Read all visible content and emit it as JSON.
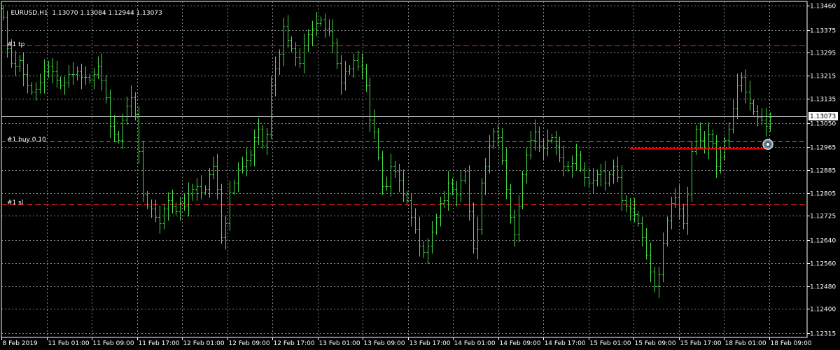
{
  "chart_info": {
    "symbol_tf": "EURUSD,H1",
    "ohlc": "1.13070 1.13084 1.12944 1.13073"
  },
  "levels": {
    "tp": {
      "label": "#1 tp",
      "price": 1.1332,
      "color": "#ff2020"
    },
    "buy": {
      "label": "#1 buy 0.10",
      "price": 1.12985,
      "color": "#20c020"
    },
    "sl": {
      "label": "#1 sl",
      "price": 1.12765,
      "color": "#ff2020"
    },
    "bid": {
      "label": "1.13073",
      "price": 1.13073
    }
  },
  "colors": {
    "background": "#000000",
    "bars": "#44dd44",
    "grid": "#8a8a8a",
    "axis_text": "#ffffff",
    "entry_line": "#ff0000"
  },
  "price_axis": {
    "ticks": [
      "1.13460",
      "1.13375",
      "1.13295",
      "1.13215",
      "1.13135",
      "1.13050",
      "1.12965",
      "1.12885",
      "1.12805",
      "1.12725",
      "1.12640",
      "1.12560",
      "1.12480",
      "1.12400",
      "1.12315"
    ]
  },
  "time_axis": {
    "labels": [
      "8 Feb 2019",
      "11 Feb 01:00",
      "11 Feb 09:00",
      "11 Feb 17:00",
      "12 Feb 01:00",
      "12 Feb 09:00",
      "12 Feb 17:00",
      "13 Feb 01:00",
      "13 Feb 09:00",
      "13 Feb 17:00",
      "14 Feb 01:00",
      "14 Feb 09:00",
      "14 Feb 17:00",
      "15 Feb 01:00",
      "15 Feb 09:00",
      "15 Feb 17:00",
      "18 Feb 01:00",
      "18 Feb 09:00"
    ]
  },
  "chart_data": {
    "type": "ohlc",
    "series": [
      {
        "name": "EURUSD,H1",
        "closes": [
          1.1342,
          1.1331,
          1.1326,
          1.1325,
          1.1327,
          1.1322,
          1.1318,
          1.1316,
          1.1317,
          1.1319,
          1.1323,
          1.1325,
          1.1323,
          1.132,
          1.1318,
          1.1319,
          1.1322,
          1.1322,
          1.1323,
          1.1321,
          1.1321,
          1.132,
          1.1322,
          1.1325,
          1.132,
          1.1314,
          1.1304,
          1.1301,
          1.1299,
          1.1306,
          1.1311,
          1.1314,
          1.1308,
          1.1295,
          1.128,
          1.1276,
          1.1275,
          1.1272,
          1.127,
          1.1275,
          1.1278,
          1.1276,
          1.1274,
          1.1277,
          1.1276,
          1.128,
          1.1282,
          1.1283,
          1.1281,
          1.1282,
          1.1287,
          1.129,
          1.1282,
          1.1265,
          1.127,
          1.1281,
          1.1284,
          1.1289,
          1.129,
          1.1292,
          1.1294,
          1.13,
          1.1303,
          1.1297,
          1.1301,
          1.1318,
          1.1324,
          1.1329,
          1.1339,
          1.1334,
          1.1331,
          1.1328,
          1.1326,
          1.1332,
          1.1336,
          1.1338,
          1.134,
          1.1341,
          1.1338,
          1.1337,
          1.1333,
          1.1326,
          1.1319,
          1.1323,
          1.1324,
          1.1327,
          1.1325,
          1.1324,
          1.1318,
          1.1306,
          1.1302,
          1.1293,
          1.1283,
          1.1283,
          1.129,
          1.1288,
          1.1285,
          1.128,
          1.1278,
          1.1272,
          1.1268,
          1.1262,
          1.126,
          1.1262,
          1.1267,
          1.1272,
          1.1277,
          1.1278,
          1.1284,
          1.1282,
          1.128,
          1.1285,
          1.1288,
          1.1274,
          1.1261,
          1.1268,
          1.1284,
          1.129,
          1.1297,
          1.1302,
          1.13,
          1.1292,
          1.1282,
          1.1272,
          1.1266,
          1.1276,
          1.1287,
          1.1294,
          1.1299,
          1.1302,
          1.1297,
          1.1296,
          1.1299,
          1.13,
          1.1297,
          1.1293,
          1.129,
          1.129,
          1.1291,
          1.1294,
          1.1289,
          1.1286,
          1.1284,
          1.1285,
          1.1287,
          1.1288,
          1.1284,
          1.1287,
          1.129,
          1.1286,
          1.1278,
          1.1276,
          1.1275,
          1.1273,
          1.127,
          1.1265,
          1.1259,
          1.1253,
          1.1248,
          1.1252,
          1.1263,
          1.1271,
          1.1277,
          1.1279,
          1.1275,
          1.127,
          1.128,
          1.1295,
          1.1303,
          1.1299,
          1.1296,
          1.1301,
          1.1298,
          1.129,
          1.1293,
          1.1299,
          1.1303,
          1.131,
          1.1318,
          1.1321,
          1.1316,
          1.1312,
          1.1309,
          1.1307,
          1.1306,
          1.1304,
          1.1307
        ]
      }
    ]
  }
}
